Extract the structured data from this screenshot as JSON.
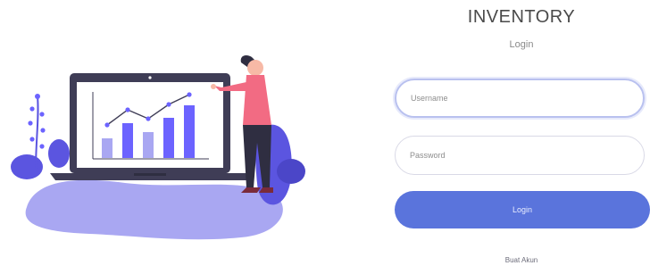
{
  "app": {
    "title": "INVENTORY",
    "subtitle": "Login"
  },
  "form": {
    "username_placeholder": "Username",
    "password_placeholder": "Password",
    "login_label": "Login",
    "register_label": "Buat Akun"
  },
  "colors": {
    "accent": "#5a74dc",
    "illustration_purple": "#6c63ff",
    "blob_light": "#a9a7f2",
    "shirt": "#f26b83"
  },
  "icons": [
    "laptop-illustration",
    "bar-chart-illustration",
    "person-illustration",
    "plant-illustration"
  ]
}
